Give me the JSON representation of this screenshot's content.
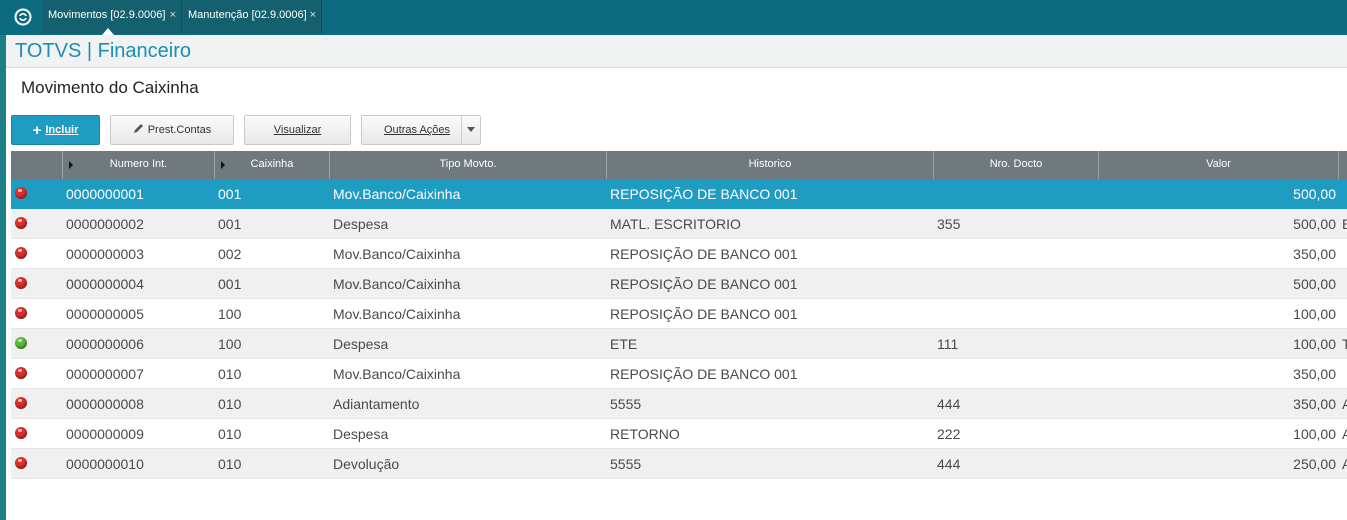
{
  "tabs": [
    {
      "label": "Movimentos [02.9.0006]",
      "close": "×"
    },
    {
      "label": "Manutenção [02.9.0006]",
      "close": "×"
    }
  ],
  "app_title": "TOTVS | Financeiro",
  "page_title": "Movimento do Caixinha",
  "toolbar": {
    "incluir": "Incluir",
    "prest_contas": "Prest.Contas",
    "visualizar": "Visualizar",
    "outras_acoes": "Outras Ações"
  },
  "colors": {
    "topbar": "#0c6b80",
    "accent": "#1e9cc2",
    "status_red": "#d9302b",
    "status_green": "#5cb838"
  },
  "grid": {
    "headers": [
      "",
      "Numero Int.",
      "Caixinha",
      "Tipo Movto.",
      "Historico",
      "Nro. Docto",
      "Valor"
    ],
    "rows": [
      {
        "status": "red",
        "numero": "0000000001",
        "caixinha": "001",
        "tipo": "Mov.Banco/Caixinha",
        "historico": "REPOSIÇÃO DE BANCO 001",
        "docto": "",
        "valor": "500,00",
        "extra": ""
      },
      {
        "status": "red",
        "numero": "0000000002",
        "caixinha": "001",
        "tipo": "Despesa",
        "historico": "MATL. ESCRITORIO",
        "docto": "355",
        "valor": "500,00",
        "extra": "E"
      },
      {
        "status": "red",
        "numero": "0000000003",
        "caixinha": "002",
        "tipo": "Mov.Banco/Caixinha",
        "historico": "REPOSIÇÃO DE BANCO 001",
        "docto": "",
        "valor": "350,00",
        "extra": ""
      },
      {
        "status": "red",
        "numero": "0000000004",
        "caixinha": "001",
        "tipo": "Mov.Banco/Caixinha",
        "historico": "REPOSIÇÃO DE BANCO 001",
        "docto": "",
        "valor": "500,00",
        "extra": ""
      },
      {
        "status": "red",
        "numero": "0000000005",
        "caixinha": "100",
        "tipo": "Mov.Banco/Caixinha",
        "historico": "REPOSIÇÃO DE BANCO 001",
        "docto": "",
        "valor": "100,00",
        "extra": ""
      },
      {
        "status": "green",
        "numero": "0000000006",
        "caixinha": "100",
        "tipo": "Despesa",
        "historico": "ETE",
        "docto": "111",
        "valor": "100,00",
        "extra": "T"
      },
      {
        "status": "red",
        "numero": "0000000007",
        "caixinha": "010",
        "tipo": "Mov.Banco/Caixinha",
        "historico": "REPOSIÇÃO DE BANCO 001",
        "docto": "",
        "valor": "350,00",
        "extra": ""
      },
      {
        "status": "red",
        "numero": "0000000008",
        "caixinha": "010",
        "tipo": "Adiantamento",
        "historico": "5555",
        "docto": "444",
        "valor": "350,00",
        "extra": "A"
      },
      {
        "status": "red",
        "numero": "0000000009",
        "caixinha": "010",
        "tipo": "Despesa",
        "historico": "RETORNO",
        "docto": "222",
        "valor": "100,00",
        "extra": "A"
      },
      {
        "status": "red",
        "numero": "0000000010",
        "caixinha": "010",
        "tipo": "Devolução",
        "historico": "5555",
        "docto": "444",
        "valor": "250,00",
        "extra": "A"
      }
    ]
  }
}
